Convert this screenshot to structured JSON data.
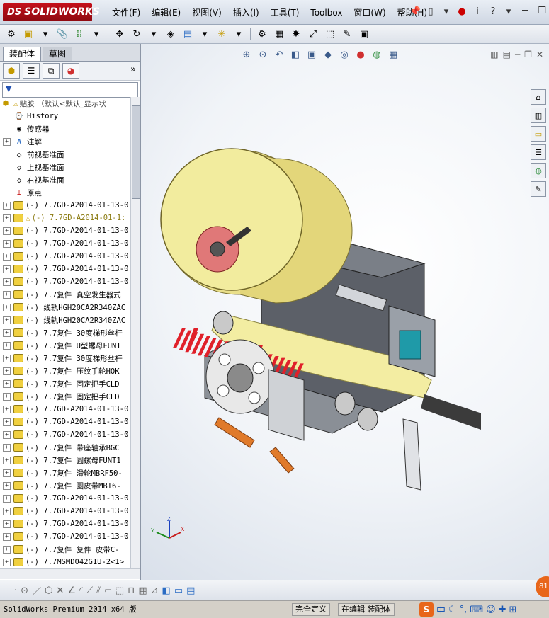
{
  "app": {
    "brand": "SOLIDWORKS",
    "brand_prefix": "DS",
    "menu": [
      "文件(F)",
      "编辑(E)",
      "视图(V)",
      "插入(I)",
      "工具(T)",
      "Toolbox",
      "窗口(W)",
      "帮助(H)"
    ],
    "window_controls": [
      "minimize",
      "restore",
      "close"
    ]
  },
  "feature_manager": {
    "tabs": [
      "装配体",
      "草图"
    ],
    "active_tab": "装配体",
    "filter_symbol": "▼",
    "more": "»",
    "root_label": "贴胶 （默认<默认_显示状",
    "items": [
      {
        "expand": false,
        "icon": "history-icon",
        "label": "History"
      },
      {
        "expand": false,
        "icon": "sensor-icon",
        "label": "传感器"
      },
      {
        "expand": true,
        "icon": "annotation-icon",
        "label": "注解"
      },
      {
        "expand": false,
        "icon": "plane-icon",
        "label": "前视基准面"
      },
      {
        "expand": false,
        "icon": "plane-icon",
        "label": "上视基准面"
      },
      {
        "expand": false,
        "icon": "plane-icon",
        "label": "右视基准面"
      },
      {
        "expand": false,
        "icon": "origin-icon",
        "label": "原点"
      },
      {
        "expand": true,
        "icon": "component-icon",
        "label": "(-) 7.7GD-A2014-01-13-0"
      },
      {
        "expand": true,
        "icon": "component-icon",
        "warn": true,
        "label": "(-) 7.7GD-A2014-01-1:"
      },
      {
        "expand": true,
        "icon": "component-icon",
        "label": "(-) 7.7GD-A2014-01-13-0"
      },
      {
        "expand": true,
        "icon": "component-icon",
        "label": "(-) 7.7GD-A2014-01-13-0"
      },
      {
        "expand": true,
        "icon": "component-icon",
        "label": "(-) 7.7GD-A2014-01-13-0"
      },
      {
        "expand": true,
        "icon": "component-icon",
        "label": "(-) 7.7GD-A2014-01-13-0"
      },
      {
        "expand": true,
        "icon": "component-icon",
        "label": "(-) 7.7GD-A2014-01-13-0"
      },
      {
        "expand": true,
        "icon": "component-icon",
        "label": "(-) 7.7复件 真空发生器式"
      },
      {
        "expand": true,
        "icon": "component-icon",
        "label": "(-) 线轨HGH20CA2R340ZAC"
      },
      {
        "expand": true,
        "icon": "component-icon",
        "label": "(-) 线轨HGH20CA2R340ZAC"
      },
      {
        "expand": true,
        "icon": "component-icon",
        "label": "(-) 7.7复件 30度梯形丝杆"
      },
      {
        "expand": true,
        "icon": "component-icon",
        "label": "(-) 7.7复件 U型螺母FUNT"
      },
      {
        "expand": true,
        "icon": "component-icon",
        "label": "(-) 7.7复件 30度梯形丝杆"
      },
      {
        "expand": true,
        "icon": "component-icon",
        "label": "(-) 7.7复件 压纹手轮HOK"
      },
      {
        "expand": true,
        "icon": "component-icon",
        "label": "(-) 7.7复件 固定把手CLD"
      },
      {
        "expand": true,
        "icon": "component-icon",
        "label": "(-) 7.7复件 固定把手CLD"
      },
      {
        "expand": true,
        "icon": "component-icon",
        "label": "(-) 7.7GD-A2014-01-13-0"
      },
      {
        "expand": true,
        "icon": "component-icon",
        "label": "(-) 7.7GD-A2014-01-13-0"
      },
      {
        "expand": true,
        "icon": "component-icon",
        "label": "(-) 7.7GD-A2014-01-13-0"
      },
      {
        "expand": true,
        "icon": "component-icon",
        "label": "(-) 7.7复件 带座轴承BGC"
      },
      {
        "expand": true,
        "icon": "component-icon",
        "label": "(-) 7.7复件 圆螺母FUNT1"
      },
      {
        "expand": true,
        "icon": "component-icon",
        "label": "(-) 7.7复件 滑轮MBRF50-"
      },
      {
        "expand": true,
        "icon": "component-icon",
        "label": "(-) 7.7复件 圆皮带MBT6-"
      },
      {
        "expand": true,
        "icon": "component-icon",
        "label": "(-) 7.7GD-A2014-01-13-0"
      },
      {
        "expand": true,
        "icon": "component-icon",
        "label": "(-) 7.7GD-A2014-01-13-0"
      },
      {
        "expand": true,
        "icon": "component-icon",
        "label": "(-) 7.7GD-A2014-01-13-0"
      },
      {
        "expand": true,
        "icon": "component-icon",
        "label": "(-) 7.7GD-A2014-01-13-0"
      },
      {
        "expand": true,
        "icon": "component-icon",
        "label": "(-) 7.7复件 复件 皮带C-"
      },
      {
        "expand": true,
        "icon": "component-icon",
        "label": "(-) 7.7MSMD042G1U-2<1>"
      }
    ]
  },
  "triad": {
    "x": "X",
    "y": "Y",
    "z": "Z"
  },
  "status": {
    "product": "SolidWorks Premium 2014 x64 版",
    "state": "完全定义",
    "mode": "在编辑 装配体",
    "ime_label": "中",
    "badge": "81"
  }
}
